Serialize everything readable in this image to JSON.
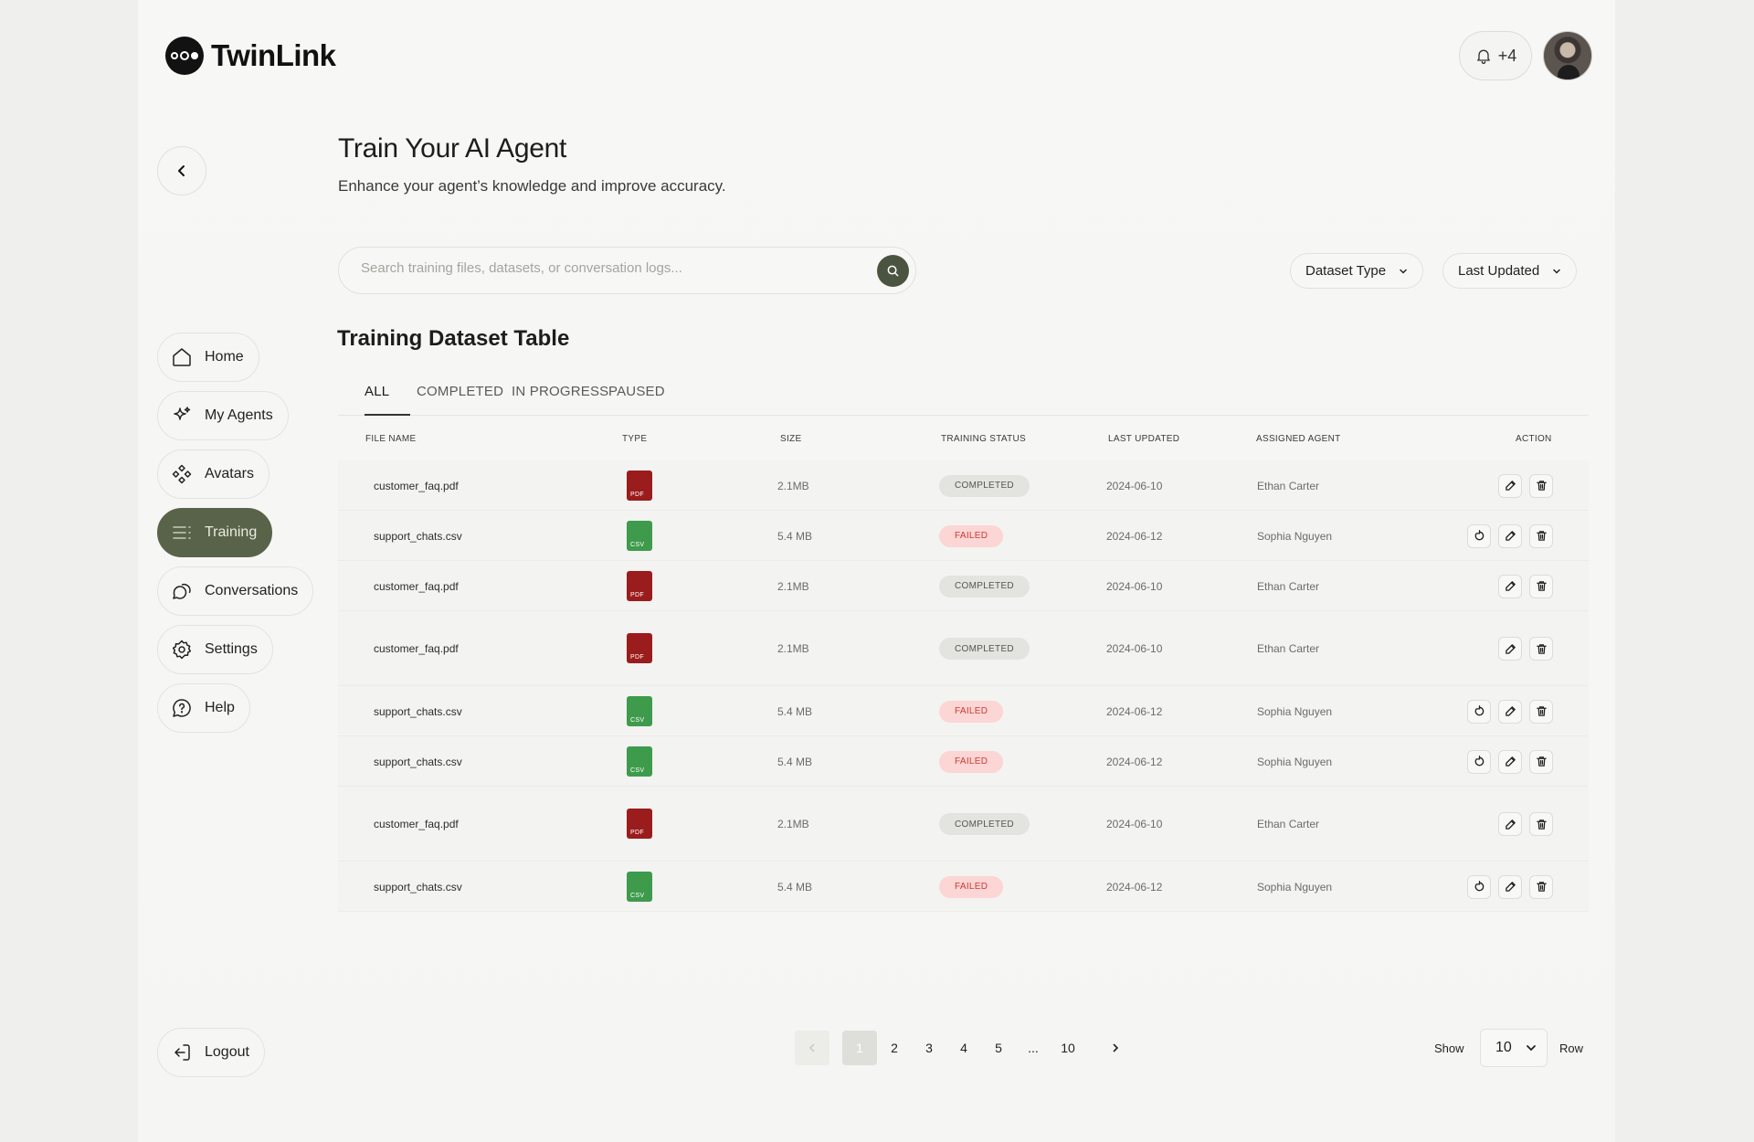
{
  "app": {
    "name": "TwinLink"
  },
  "header": {
    "notification_count": "+4"
  },
  "page": {
    "title": "Train Your AI Agent",
    "subtitle": "Enhance your agent’s knowledge and improve accuracy."
  },
  "sidebar": {
    "items": [
      {
        "label": "Home",
        "icon": "home-icon"
      },
      {
        "label": "My Agents",
        "icon": "sparkle-icon"
      },
      {
        "label": "Avatars",
        "icon": "diamond-grid-icon"
      },
      {
        "label": "Training",
        "icon": "list-icon",
        "active": true
      },
      {
        "label": "Conversations",
        "icon": "chat-icon"
      },
      {
        "label": "Settings",
        "icon": "gear-icon"
      },
      {
        "label": "Help",
        "icon": "help-icon"
      }
    ],
    "logout_label": "Logout"
  },
  "search": {
    "placeholder": "Search training files, datasets, or conversation logs..."
  },
  "filters": {
    "dataset_type": "Dataset Type",
    "last_updated": "Last Updated"
  },
  "table": {
    "title": "Training Dataset Table",
    "tabs": [
      "ALL",
      "COMPLETED",
      "IN PROGRESS",
      "PAUSED"
    ],
    "columns": [
      "FILE NAME",
      "TYPE",
      "SIZE",
      "TRAINING STATUS",
      "LAST UPDATED",
      "ASSIGNED AGENT",
      "ACTION"
    ],
    "rows": [
      {
        "file_name": "customer_faq.pdf",
        "type": "PDF",
        "size": "2.1MB",
        "status": "COMPLETED",
        "last_updated": "2024-06-10",
        "agent": "Ethan Carter",
        "retry": false
      },
      {
        "file_name": "support_chats.csv",
        "type": "CSV",
        "size": "5.4 MB",
        "status": "FAILED",
        "last_updated": "2024-06-12",
        "agent": "Sophia Nguyen",
        "retry": true
      },
      {
        "file_name": "customer_faq.pdf",
        "type": "PDF",
        "size": "2.1MB",
        "status": "COMPLETED",
        "last_updated": "2024-06-10",
        "agent": "Ethan Carter",
        "retry": false
      },
      {
        "file_name": "customer_faq.pdf",
        "type": "PDF",
        "size": "2.1MB",
        "status": "COMPLETED",
        "last_updated": "2024-06-10",
        "agent": "Ethan Carter",
        "retry": false
      },
      {
        "file_name": "support_chats.csv",
        "type": "CSV",
        "size": "5.4 MB",
        "status": "FAILED",
        "last_updated": "2024-06-12",
        "agent": "Sophia Nguyen",
        "retry": true
      },
      {
        "file_name": "support_chats.csv",
        "type": "CSV",
        "size": "5.4 MB",
        "status": "FAILED",
        "last_updated": "2024-06-12",
        "agent": "Sophia Nguyen",
        "retry": true
      },
      {
        "file_name": "customer_faq.pdf",
        "type": "PDF",
        "size": "2.1MB",
        "status": "COMPLETED",
        "last_updated": "2024-06-10",
        "agent": "Ethan Carter",
        "retry": false
      },
      {
        "file_name": "support_chats.csv",
        "type": "CSV",
        "size": "5.4 MB",
        "status": "FAILED",
        "last_updated": "2024-06-12",
        "agent": "Sophia Nguyen",
        "retry": true
      }
    ]
  },
  "pagination": {
    "pages": [
      "1",
      "2",
      "3",
      "4",
      "5",
      "...",
      "10"
    ],
    "current": "1",
    "show_label": "Show",
    "rows_per_page": "10",
    "row_label": "Row"
  },
  "colors": {
    "accent": "#59634a",
    "pdf": "#9b1c1c",
    "csv": "#3e9b4c",
    "failed_text": "#cc3a34",
    "failed_bg": "#fbd6d4"
  }
}
